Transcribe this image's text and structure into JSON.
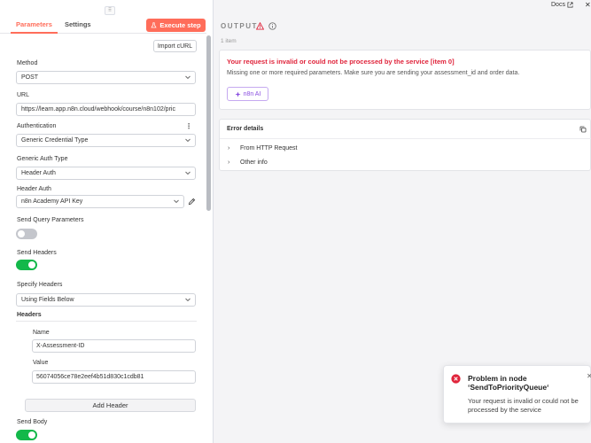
{
  "panel": {
    "tabs": [
      {
        "label": "Parameters",
        "active": true
      },
      {
        "label": "Settings",
        "active": false
      }
    ],
    "execute_label": "Execute step",
    "import_label": "Import cURL",
    "method": {
      "label": "Method",
      "value": "POST"
    },
    "url": {
      "label": "URL",
      "value": "https://learn.app.n8n.cloud/webhook/course/n8n102/pric"
    },
    "authentication": {
      "label": "Authentication",
      "value": "Generic Credential Type"
    },
    "generic_auth_type": {
      "label": "Generic Auth Type",
      "value": "Header Auth"
    },
    "header_auth": {
      "label": "Header Auth",
      "value": "n8n Academy API Key"
    },
    "send_query": {
      "label": "Send Query Parameters",
      "enabled": false
    },
    "send_headers": {
      "label": "Send Headers",
      "enabled": true
    },
    "specify_headers": {
      "label": "Specify Headers",
      "value": "Using Fields Below"
    },
    "headers_title": "Headers",
    "header_name": {
      "label": "Name",
      "value": "X-Assessment-ID"
    },
    "header_value": {
      "label": "Value",
      "value": "56074056ce78e2eef4b51d830c1cdb81"
    },
    "add_header_label": "Add Header",
    "send_body": {
      "label": "Send Body",
      "enabled": true
    }
  },
  "output": {
    "docs_label": "Docs",
    "title": "OUTPUT",
    "item_count": "1 item",
    "error_title": "Your request is invalid or could not be processed by the service [item 0]",
    "error_description": "Missing one or more required parameters. Make sure you are sending your assessment_id and order data.",
    "ai_button_label": "n8n AI",
    "details_title": "Error details",
    "details_rows": [
      "From HTTP Request",
      "Other info"
    ]
  },
  "toast": {
    "title": "Problem in node ‘SendToPriorityQueue‘",
    "message": "Your request is invalid or could not be processed by the service"
  },
  "colors": {
    "accent": "#ff6d5a",
    "error": "#e0243b",
    "toggle_on": "#13b84a",
    "ai": "#8a4fe0"
  }
}
